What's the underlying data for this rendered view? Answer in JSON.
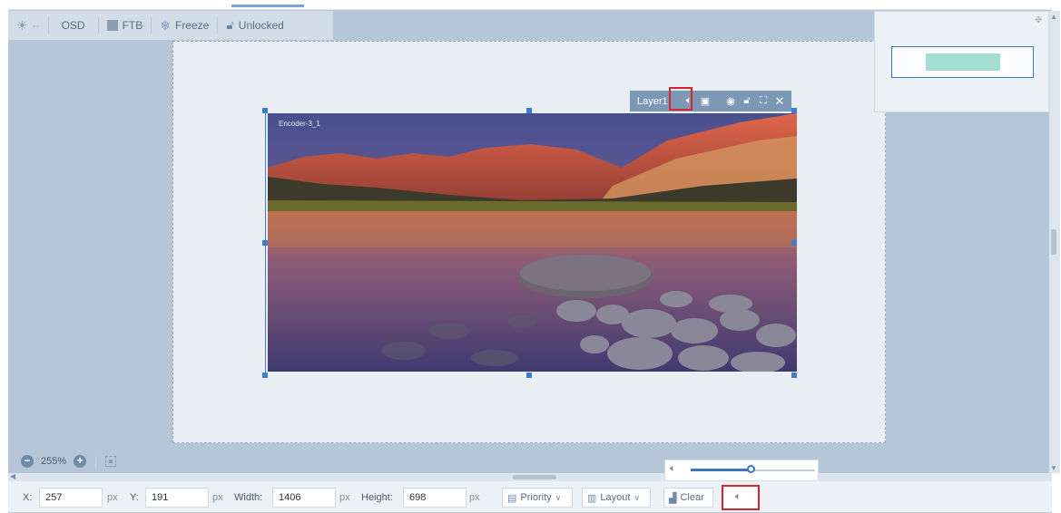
{
  "toolbar": {
    "brightness_value": "--",
    "osd_label": "OSD",
    "ftb_label": "FTB",
    "freeze_label": "Freeze",
    "lock_label": "Unlocked"
  },
  "layer": {
    "name": "Layer1",
    "source_label": "Encoder-3_1"
  },
  "zoom": {
    "value": "255%"
  },
  "volume": {
    "level": 0.48
  },
  "properties": {
    "x_label": "X:",
    "x_value": "257",
    "y_label": "Y:",
    "y_value": "191",
    "width_label": "Width:",
    "width_value": "1406",
    "height_label": "Height:",
    "height_value": "698",
    "unit": "px"
  },
  "buttons": {
    "priority": "Priority",
    "layout": "Layout",
    "clear": "Clear"
  },
  "colors": {
    "accent": "#3f74c4",
    "highlight": "#d8262f",
    "workspace": "#b5c6d8"
  }
}
